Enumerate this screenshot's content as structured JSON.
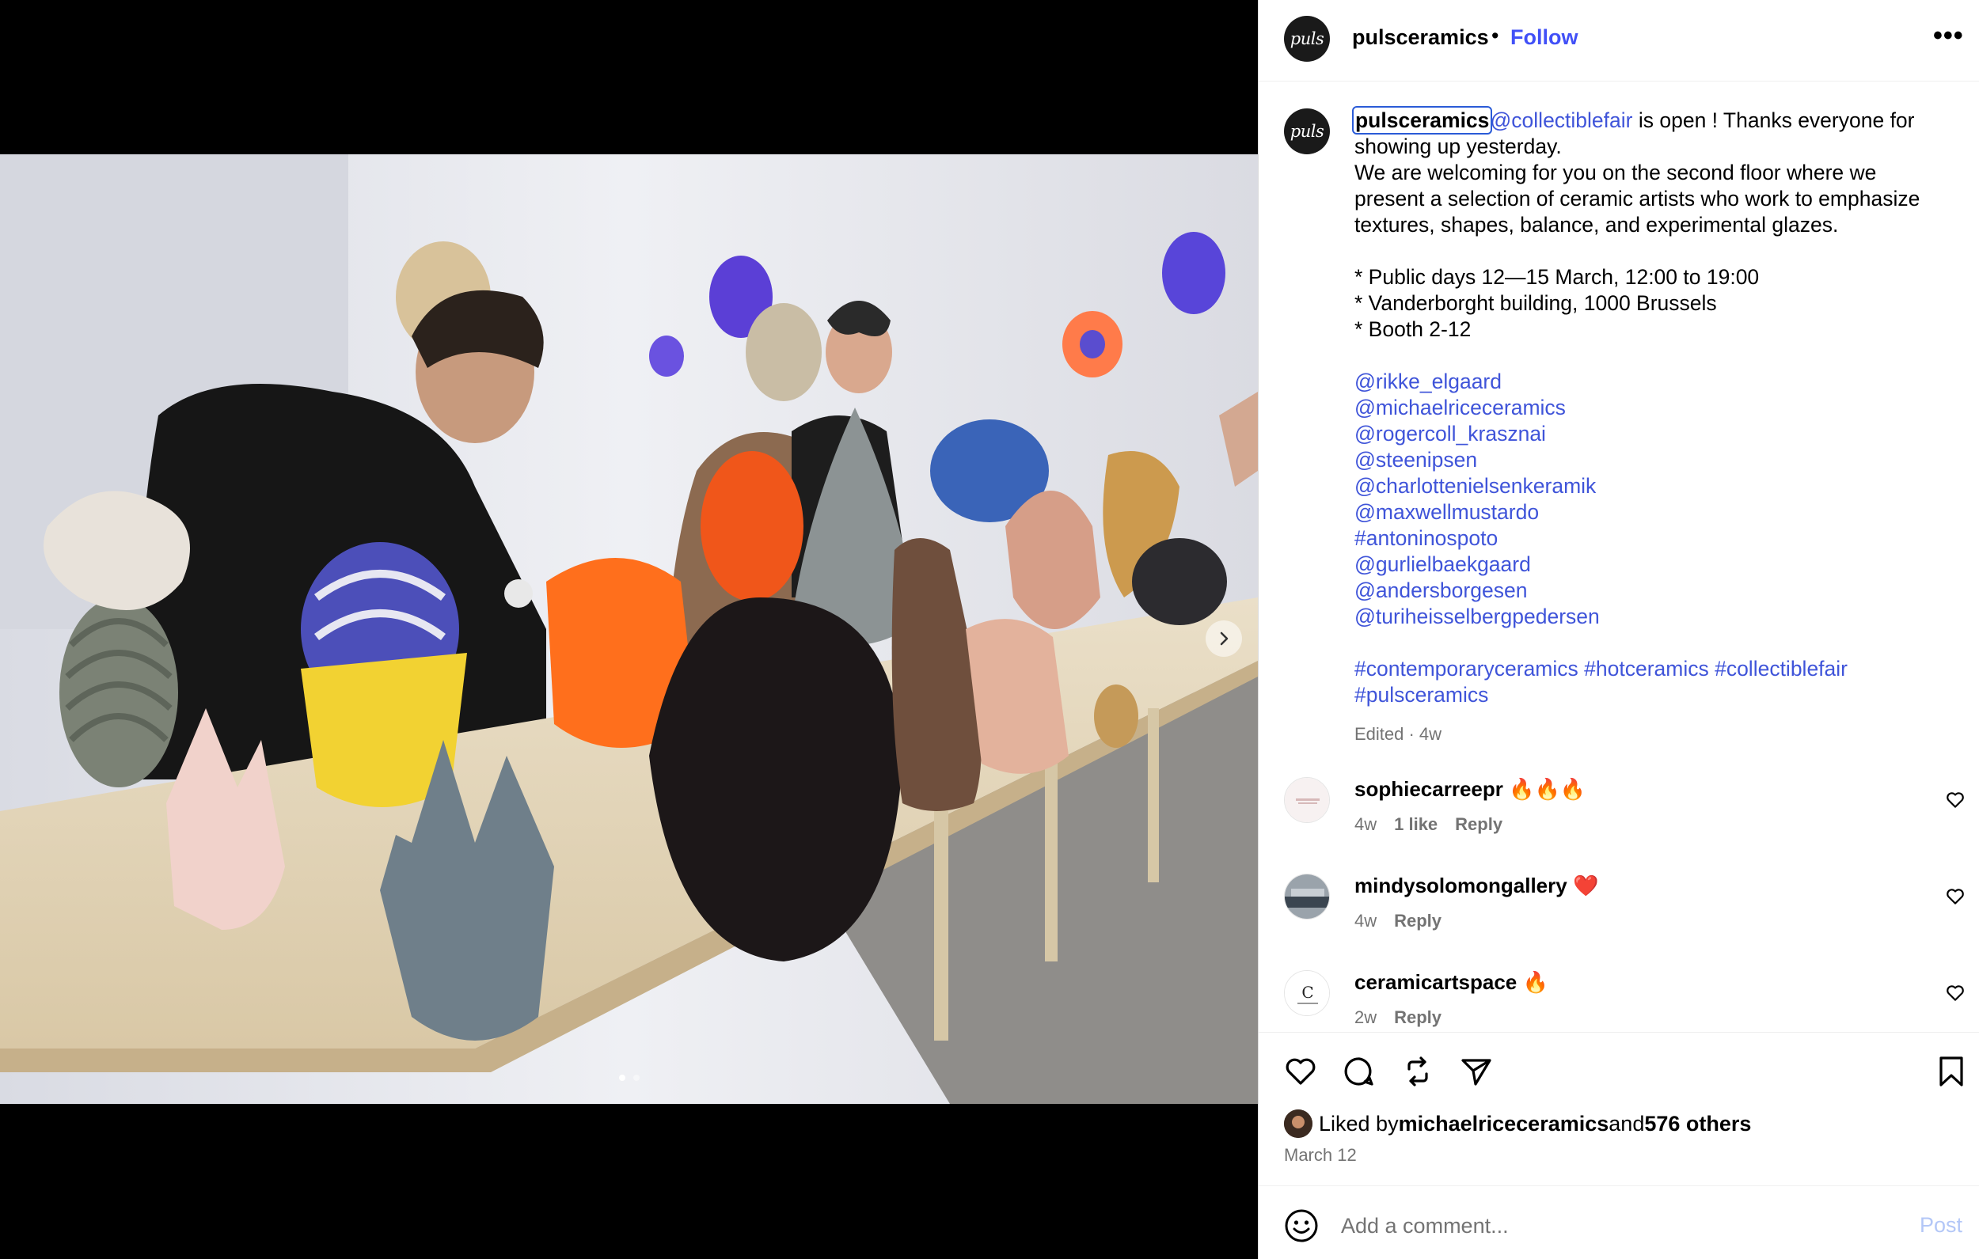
{
  "post": {
    "username": "pulsceramics",
    "avatar_text": "puls",
    "separator": "•",
    "follow_label": "Follow",
    "more_icon": "more-horizontal-icon",
    "more_label": "•••"
  },
  "caption": {
    "username": "pulsceramics",
    "mention_fair": "@collectiblefair",
    "line1_rest": " is open ! Thanks everyone for",
    "line2": "showing up yesterday.",
    "line3": "We are welcoming for you on the second floor where we",
    "line4": "present a selection of ceramic artists who work to emphasize",
    "line5": "textures, shapes, balance, and experimental glazes.",
    "bullet1": "* Public days 12—15 March, 12:00 to 19:00",
    "bullet2": "* Vanderborght building, 1000 Brussels",
    "bullet3": "* Booth 2-12",
    "tags": [
      "@rikke_elgaard",
      "@michaelriceceramics",
      "@rogercoll_krasznai",
      "@steenipsen",
      "@charlottenielsenkeramik",
      "@maxwellmustardo",
      "#antoninospoto",
      "@gurlielbaekgaard",
      "@andersborgesen",
      "@turiheisselbergpedersen"
    ],
    "hashtags_line1": "#contemporaryceramics #hotceramics #collectiblefair",
    "hashtags_line2": "#pulsceramics",
    "edited": "Edited · 4w"
  },
  "comments": [
    {
      "user": "sophiecarreepr",
      "text": "🔥🔥🔥",
      "time": "4w",
      "likes": "1 like",
      "reply": "Reply"
    },
    {
      "user": "mindysolomongallery",
      "text": "❤️",
      "time": "4w",
      "likes": "",
      "reply": "Reply"
    },
    {
      "user": "ceramicartspace",
      "text": "🔥",
      "time": "2w",
      "likes": "",
      "reply": "Reply"
    }
  ],
  "actions": {
    "like_icon": "heart-icon",
    "comment_icon": "comment-icon",
    "repost_icon": "repost-icon",
    "share_icon": "send-icon",
    "save_icon": "bookmark-icon"
  },
  "likes": {
    "prefix": "Liked by ",
    "user": "michaelriceceramics",
    "middle": " and ",
    "others": "576 others"
  },
  "date": "March 12",
  "add_comment": {
    "placeholder": "Add a comment...",
    "post_label": "Post",
    "emoji_icon": "smiley-icon"
  },
  "colors": {
    "link": "#3f54d9",
    "follow": "#4150f7",
    "muted": "#737373",
    "post_disabled": "#b3c7f7"
  }
}
